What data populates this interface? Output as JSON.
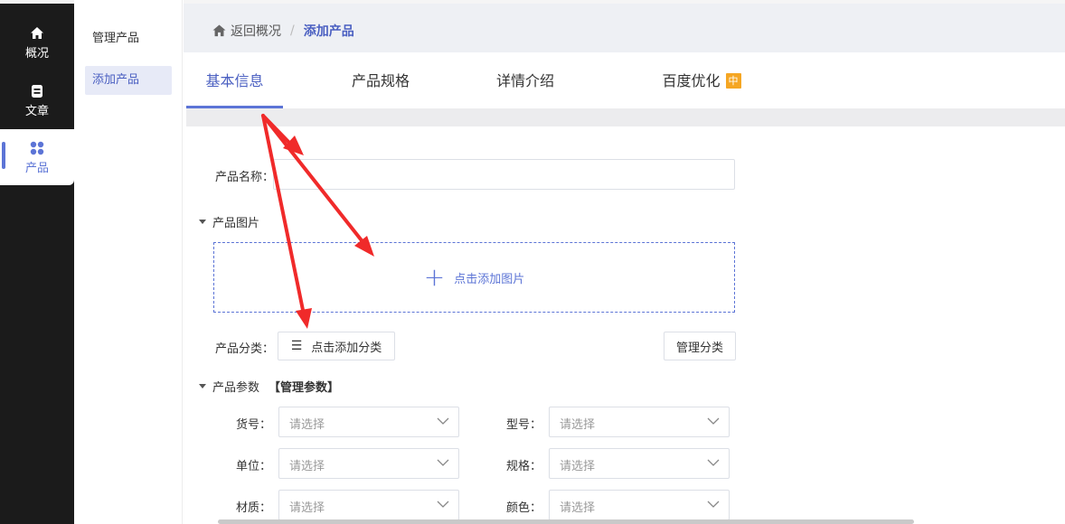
{
  "rail": {
    "items": [
      {
        "label": "概况",
        "icon": "home-icon"
      },
      {
        "label": "文章",
        "icon": "document-icon"
      },
      {
        "label": "产品",
        "icon": "grid-icon"
      }
    ]
  },
  "subnav": {
    "items": [
      {
        "label": "管理产品"
      },
      {
        "label": "添加产品"
      }
    ]
  },
  "breadcrumb": {
    "back": "返回概况",
    "separator": "/",
    "current": "添加产品"
  },
  "tabs": [
    {
      "label": "基本信息"
    },
    {
      "label": "产品规格"
    },
    {
      "label": "详情介绍"
    },
    {
      "label": "百度优化",
      "badge": "中"
    }
  ],
  "form": {
    "name_label": "产品名称：",
    "images_title": "产品图片",
    "upload_label": "点击添加图片",
    "category_label": "产品分类：",
    "category_button": "点击添加分类",
    "manage_category_button": "管理分类",
    "params_title": "产品参数",
    "params_manage": "【管理参数】",
    "params": [
      {
        "label": "货号：",
        "placeholder": "请选择"
      },
      {
        "label": "型号：",
        "placeholder": "请选择"
      },
      {
        "label": "单位：",
        "placeholder": "请选择"
      },
      {
        "label": "规格：",
        "placeholder": "请选择"
      },
      {
        "label": "材质：",
        "placeholder": "请选择"
      },
      {
        "label": "颜色：",
        "placeholder": "请选择"
      }
    ]
  },
  "colors": {
    "accent": "#5c74d6",
    "badge": "#f5a623",
    "annotation_arrow": "#f02a2a"
  }
}
